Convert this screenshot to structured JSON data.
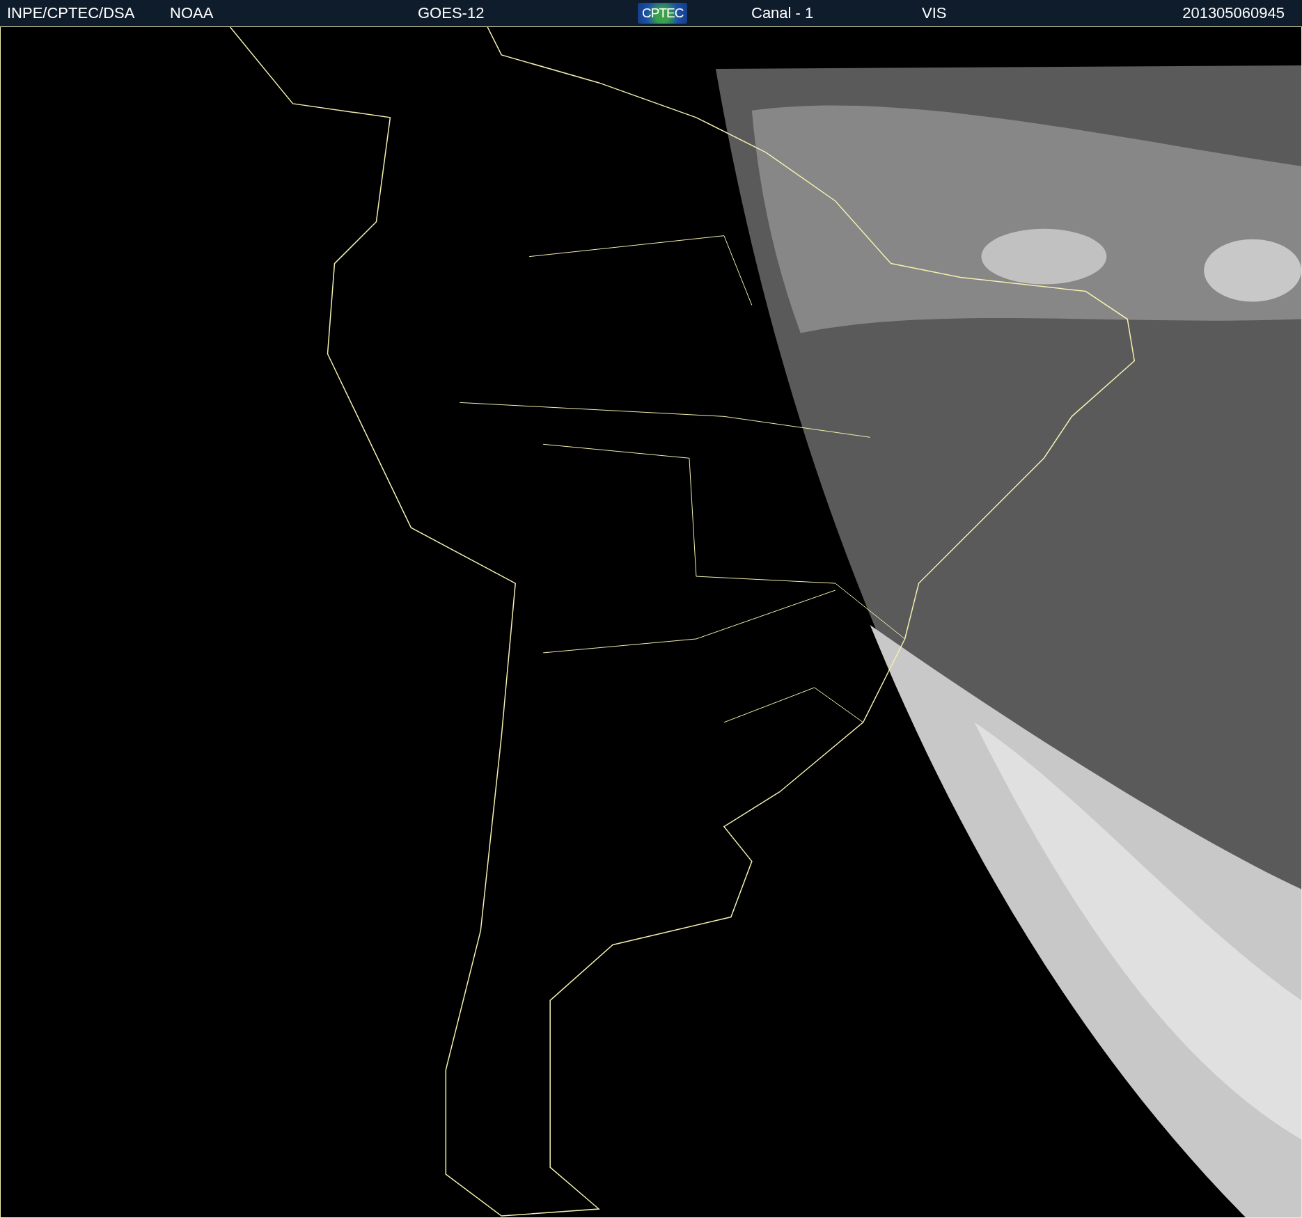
{
  "header": {
    "items": [
      {
        "kind": "text",
        "text": "INPE/CPTEC/DSA"
      },
      {
        "kind": "text",
        "text": "NOAA"
      },
      {
        "kind": "text",
        "text": "GOES-12"
      },
      {
        "kind": "logo",
        "text": "CPTEC"
      },
      {
        "kind": "text",
        "text": "Canal - 1"
      },
      {
        "kind": "text",
        "text": "VIS"
      },
      {
        "kind": "text",
        "text": "201305060945"
      }
    ]
  }
}
